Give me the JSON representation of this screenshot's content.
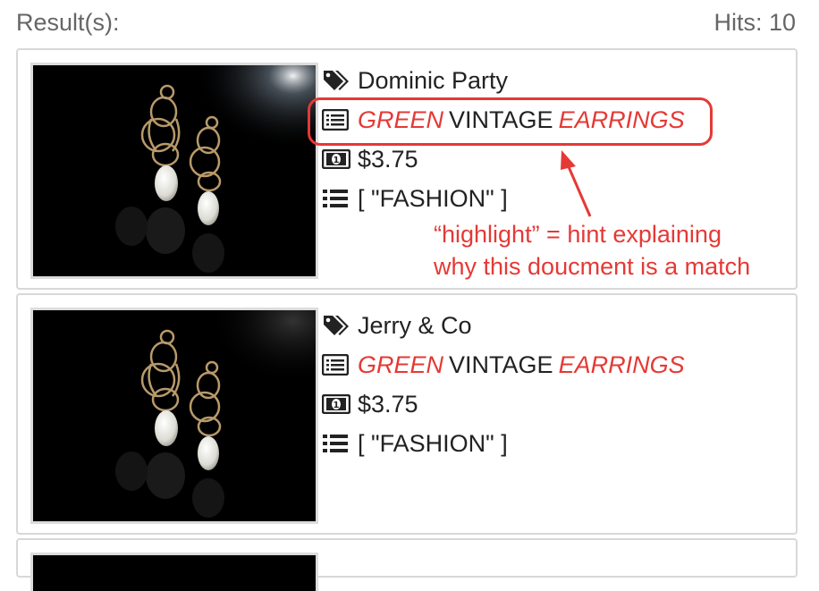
{
  "header": {
    "results_label": "Result(s):",
    "hits": "Hits: 10"
  },
  "results": [
    {
      "brand": "Dominic Party",
      "title": {
        "part1": "GREEN",
        "part2": "VINTAGE",
        "part3": "EARRINGS"
      },
      "price": "$3.75",
      "categories": "[ \"FASHION\" ]",
      "icons": [
        "tags-icon",
        "list-alt-icon",
        "money-icon",
        "list-icon"
      ]
    },
    {
      "brand": "Jerry & Co",
      "title": {
        "part1": "GREEN",
        "part2": "VINTAGE",
        "part3": "EARRINGS"
      },
      "price": "$3.75",
      "categories": "[ \"FASHION\" ]",
      "icons": [
        "tags-icon",
        "list-alt-icon",
        "money-icon",
        "list-icon"
      ]
    }
  ],
  "annotation": {
    "line1": "“highlight” = hint explaining",
    "line2": "why this doucment is a match"
  },
  "colors": {
    "highlight": "#e53935",
    "border": "#d8d8d8",
    "muted_text": "#666666"
  }
}
